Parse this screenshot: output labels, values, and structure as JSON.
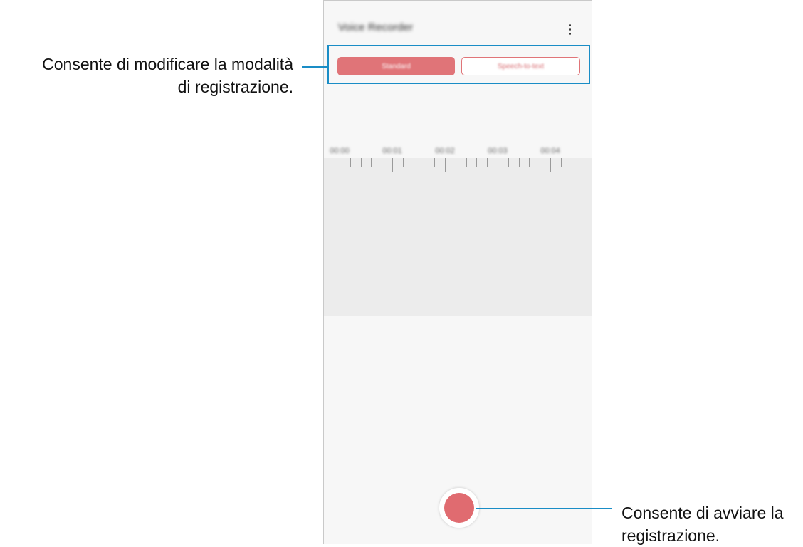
{
  "app": {
    "title": "Voice Recorder",
    "more_icon": "more-vertical-icon"
  },
  "modes": {
    "standard_label": "Standard",
    "speech_to_text_label": "Speech-to-text",
    "active": "Standard"
  },
  "timeline": {
    "labels": [
      "00:00",
      "00:01",
      "00:02",
      "00:03",
      "00:04"
    ]
  },
  "record": {
    "icon": "record-icon"
  },
  "annotations": {
    "mode_callout_line1": "Consente di modificare la modalità",
    "mode_callout_line2": "di registrazione.",
    "record_callout_line1": "Consente di avviare la",
    "record_callout_line2": "registrazione."
  },
  "colors": {
    "accent_record": "#e06b70",
    "callout_line": "#1a8dc6"
  }
}
